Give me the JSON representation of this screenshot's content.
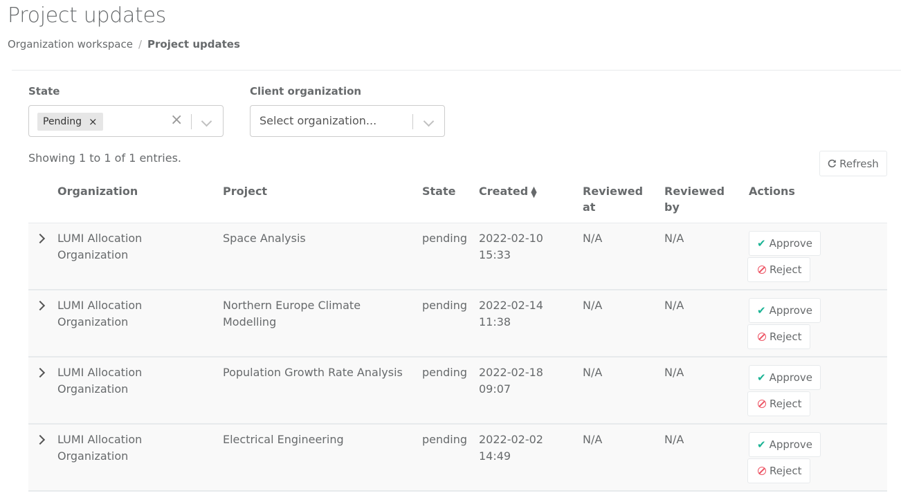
{
  "header": {
    "title": "Project updates",
    "breadcrumb": [
      "Organization workspace",
      "/",
      "Project updates"
    ]
  },
  "filters": {
    "state_label": "State",
    "state_selected": "Pending",
    "state_tag_remove": "×",
    "client_label": "Client organization",
    "client_placeholder": "Select organization..."
  },
  "summary": "Showing 1 to 1 of 1 entries.",
  "refresh_label": "Refresh",
  "table": {
    "columns": [
      "Organization",
      "Project",
      "State",
      "Created",
      "Reviewed at",
      "Reviewed by",
      "Actions"
    ],
    "rows": [
      {
        "organization": "LUMI Allocation Organization",
        "project": "Space Analysis",
        "state": "pending",
        "created": "2022-02-10 15:33",
        "reviewed_at": "N/A",
        "reviewed_by": "N/A"
      },
      {
        "organization": "LUMI Allocation Organization",
        "project": "Northern Europe Climate Modelling",
        "state": "pending",
        "created": "2022-02-14 11:38",
        "reviewed_at": "N/A",
        "reviewed_by": "N/A"
      },
      {
        "organization": "LUMI Allocation Organization",
        "project": "Population Growth Rate Analysis",
        "state": "pending",
        "created": "2022-02-18 09:07",
        "reviewed_at": "N/A",
        "reviewed_by": "N/A"
      },
      {
        "organization": "LUMI Allocation Organization",
        "project": "Electrical Engineering",
        "state": "pending",
        "created": "2022-02-02 14:49",
        "reviewed_at": "N/A",
        "reviewed_by": "N/A"
      }
    ],
    "approve_label": "Approve",
    "reject_label": "Reject"
  },
  "colors": {
    "approve_check": "#1ab394",
    "reject_icon": "#ed5565",
    "row_bg": "#f9f9f9"
  },
  "icons": {
    "refresh": "refresh-icon",
    "approve": "check-icon",
    "reject": "ban-icon",
    "expand": "chevron-right-icon",
    "sort": "sort-icon"
  }
}
